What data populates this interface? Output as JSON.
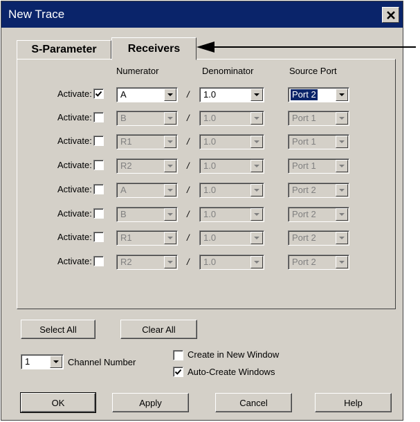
{
  "window": {
    "title": "New Trace"
  },
  "tabs": [
    {
      "label": "S-Parameter",
      "active": false
    },
    {
      "label": "Receivers",
      "active": true
    }
  ],
  "headers": {
    "numerator": "Numerator",
    "denominator": "Denominator",
    "source_port": "Source Port"
  },
  "rows": [
    {
      "label": "Activate:",
      "checked": true,
      "numerator": "A",
      "denominator": "1.0",
      "source_port": "Port 2",
      "enabled": true
    },
    {
      "label": "Activate:",
      "checked": false,
      "numerator": "B",
      "denominator": "1.0",
      "source_port": "Port 1",
      "enabled": false
    },
    {
      "label": "Activate:",
      "checked": false,
      "numerator": "R1",
      "denominator": "1.0",
      "source_port": "Port 1",
      "enabled": false
    },
    {
      "label": "Activate:",
      "checked": false,
      "numerator": "R2",
      "denominator": "1.0",
      "source_port": "Port 1",
      "enabled": false
    },
    {
      "label": "Activate:",
      "checked": false,
      "numerator": "A",
      "denominator": "1.0",
      "source_port": "Port 2",
      "enabled": false
    },
    {
      "label": "Activate:",
      "checked": false,
      "numerator": "B",
      "denominator": "1.0",
      "source_port": "Port 2",
      "enabled": false
    },
    {
      "label": "Activate:",
      "checked": false,
      "numerator": "R1",
      "denominator": "1.0",
      "source_port": "Port 2",
      "enabled": false
    },
    {
      "label": "Activate:",
      "checked": false,
      "numerator": "R2",
      "denominator": "1.0",
      "source_port": "Port 2",
      "enabled": false
    }
  ],
  "slash": "/",
  "buttons": {
    "select_all": "Select All",
    "clear_all": "Clear All",
    "ok": "OK",
    "apply": "Apply",
    "cancel": "Cancel",
    "help": "Help"
  },
  "channel": {
    "value": "1",
    "label": "Channel Number"
  },
  "options": [
    {
      "label": "Create in New Window",
      "checked": false
    },
    {
      "label": "Auto-Create Windows",
      "checked": true
    }
  ],
  "colors": {
    "title_bar": "#0a246a",
    "face": "#d4d0c8"
  },
  "icons": {
    "close": "close-icon",
    "annotation": "arrow-left-icon"
  }
}
